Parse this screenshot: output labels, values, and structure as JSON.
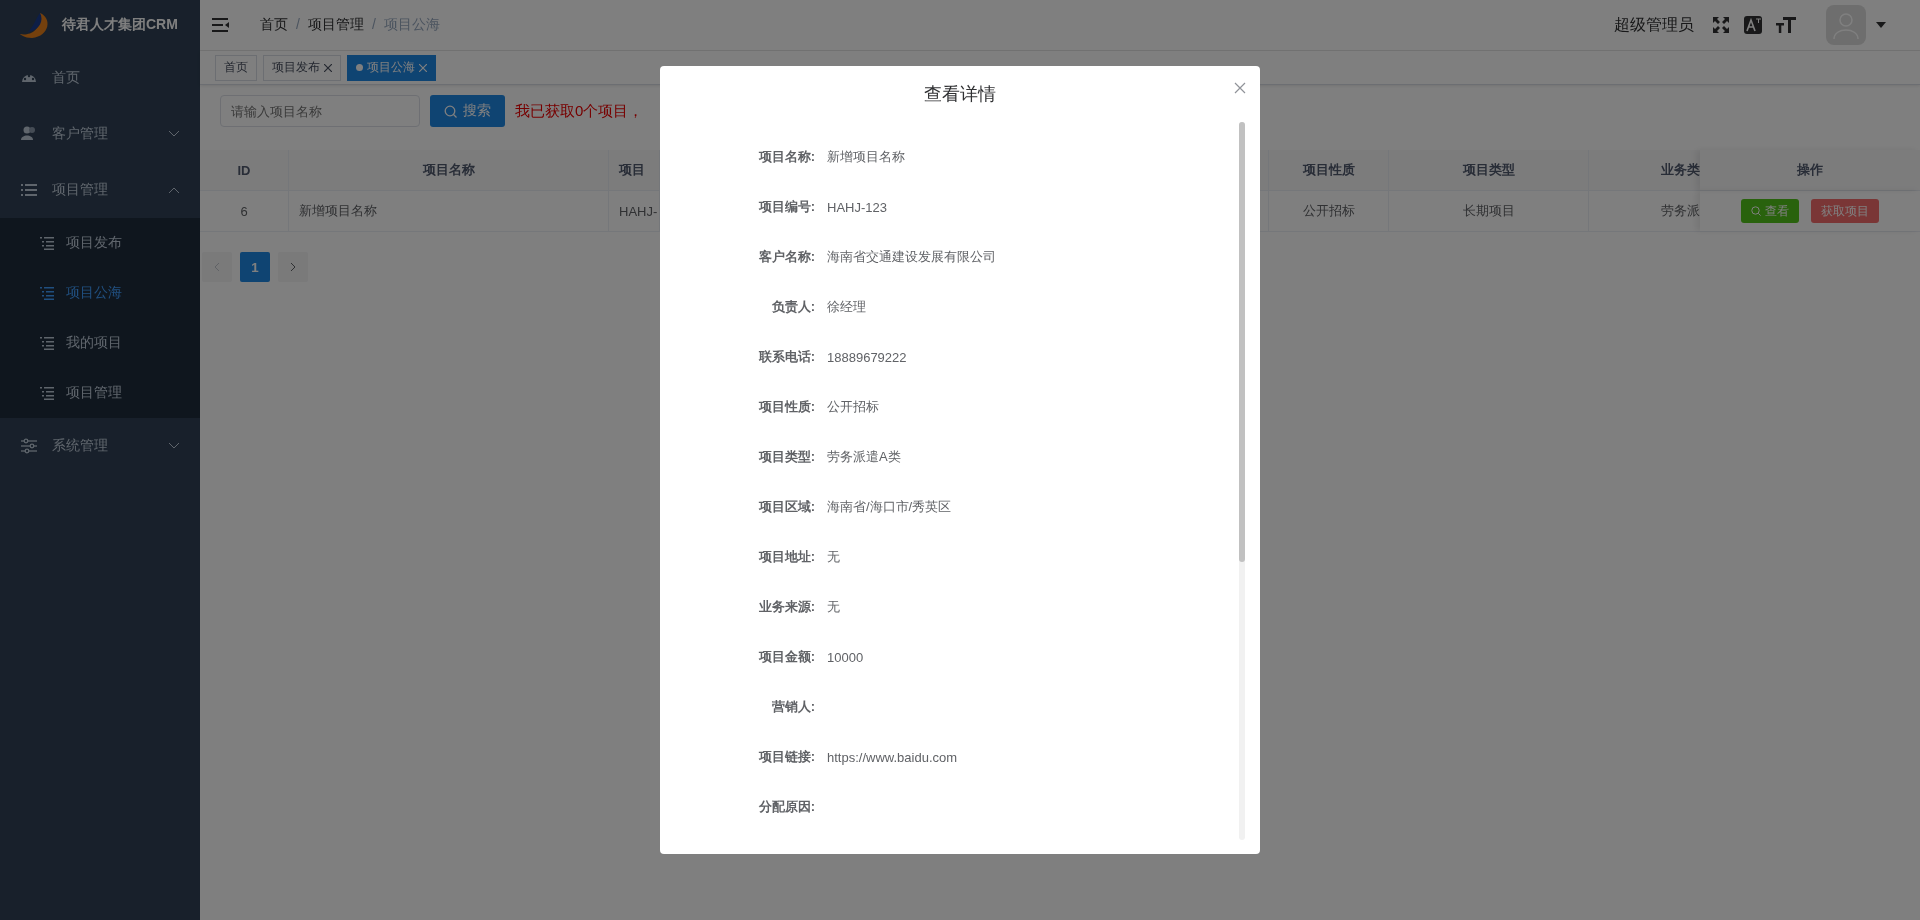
{
  "sidebar": {
    "logo_text": "待君人才集团CRM",
    "items": [
      {
        "label": "首页",
        "kind": "link"
      },
      {
        "label": "客户管理",
        "kind": "group",
        "expanded": false
      },
      {
        "label": "项目管理",
        "kind": "group",
        "expanded": true,
        "children": [
          {
            "label": "项目发布",
            "selected": false
          },
          {
            "label": "项目公海",
            "selected": true
          },
          {
            "label": "我的项目",
            "selected": false
          },
          {
            "label": "项目管理",
            "selected": false
          }
        ]
      },
      {
        "label": "系统管理",
        "kind": "group",
        "expanded": false
      }
    ]
  },
  "header": {
    "breadcrumb": [
      "首页",
      "项目管理",
      "项目公海"
    ],
    "breadcrumb_separator": "/",
    "user": "超级管理员"
  },
  "tags": [
    {
      "label": "首页",
      "selected": false,
      "closable": false
    },
    {
      "label": "项目发布",
      "selected": false,
      "closable": true
    },
    {
      "label": "项目公海",
      "selected": true,
      "closable": true
    }
  ],
  "search": {
    "placeholder": "请输入项目名称",
    "button": "搜索",
    "notice": "我已获取0个项目，"
  },
  "table": {
    "columns": [
      "ID",
      "项目名称",
      "项目",
      "项目性质",
      "项目类型",
      "业务类",
      "操作"
    ],
    "rows": [
      {
        "cells": [
          "6",
          "新增项目名称",
          "HAHJ-",
          "公开招标",
          "长期项目",
          "劳务派"
        ],
        "actions": [
          {
            "label": "查看",
            "kind": "view"
          },
          {
            "label": "获取项目",
            "kind": "take"
          }
        ]
      }
    ]
  },
  "pagination": {
    "pages": [
      {
        "label": "1",
        "selected": true
      }
    ]
  },
  "modal": {
    "title": "查看详情",
    "fields": [
      {
        "label": "项目名称:",
        "value": "新增项目名称"
      },
      {
        "label": "项目编号:",
        "value": "HAHJ-123"
      },
      {
        "label": "客户名称:",
        "value": "海南省交通建设发展有限公司"
      },
      {
        "label": "负责人:",
        "value": "徐经理"
      },
      {
        "label": "联系电话:",
        "value": "18889679222"
      },
      {
        "label": "项目性质:",
        "value": "公开招标"
      },
      {
        "label": "项目类型:",
        "value": "劳务派遣A类"
      },
      {
        "label": "项目区域:",
        "value": "海南省/海口市/秀英区"
      },
      {
        "label": "项目地址:",
        "value": "无"
      },
      {
        "label": "业务来源:",
        "value": "无"
      },
      {
        "label": "项目金额:",
        "value": "10000"
      },
      {
        "label": "营销人:"
      },
      {
        "label": "项目链接:",
        "value": "https://www.baidu.com"
      },
      {
        "label": "分配原因:"
      }
    ]
  }
}
